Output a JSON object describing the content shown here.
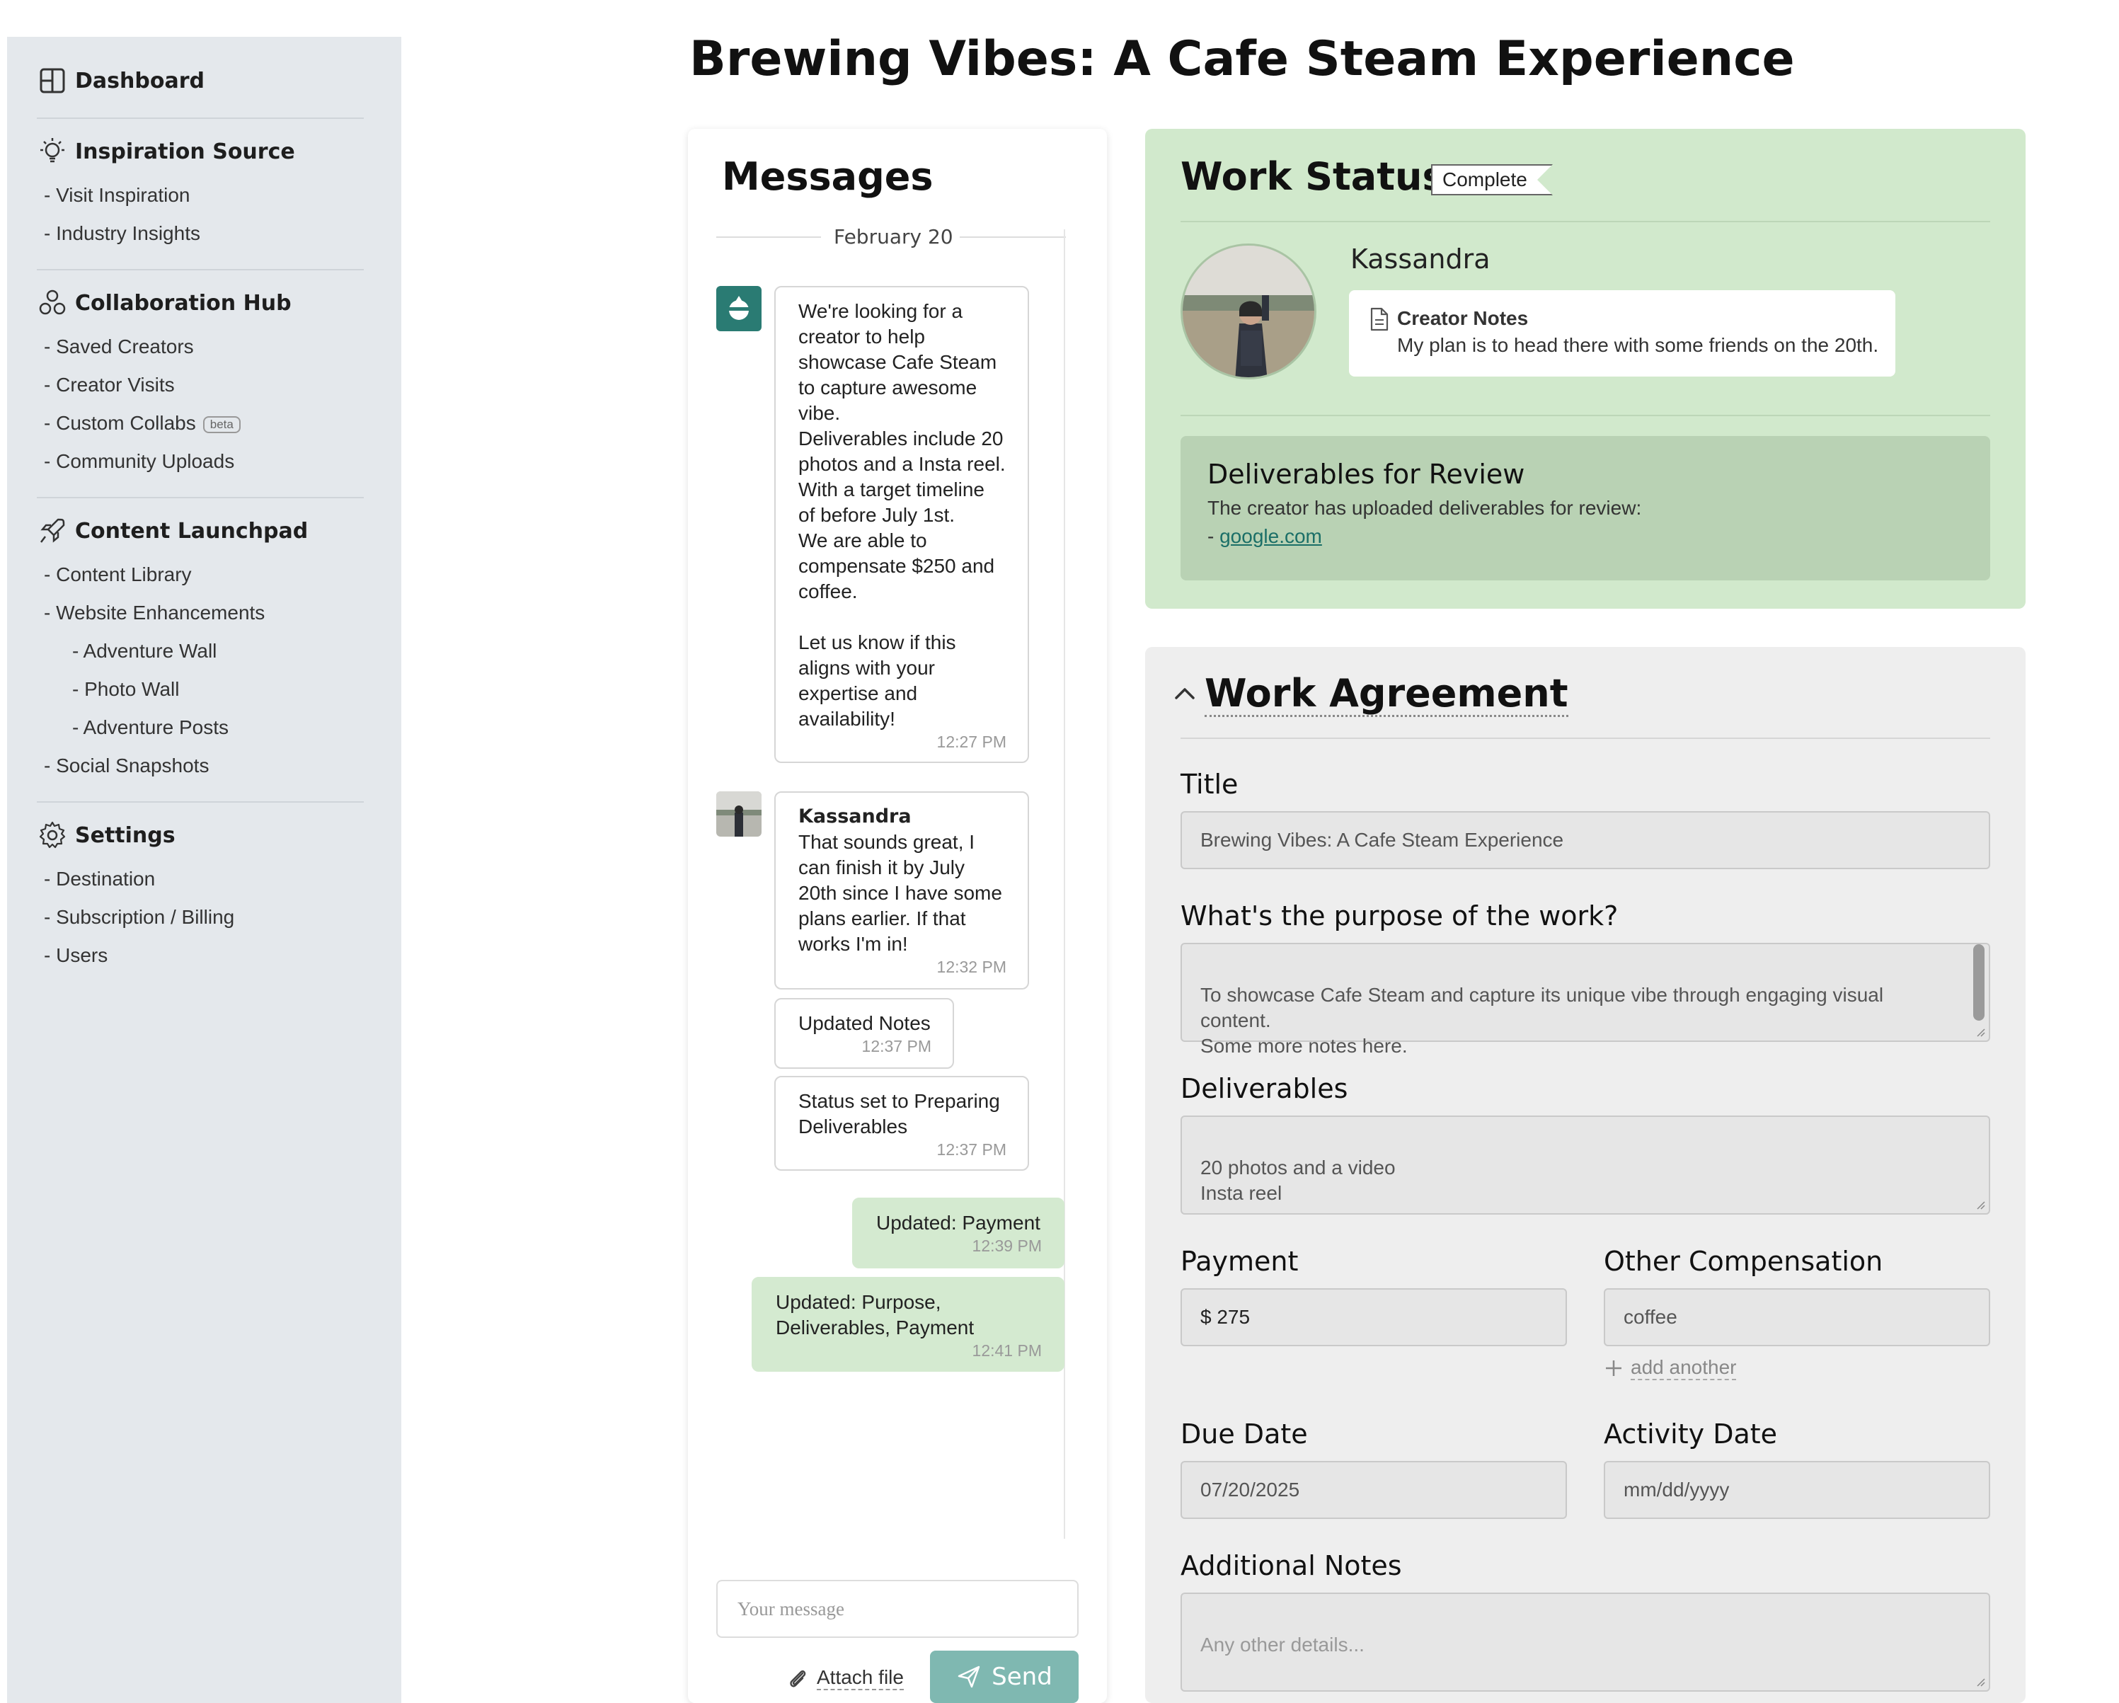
{
  "page_title": "Brewing Vibes: A Cafe Steam Experience",
  "sidebar": {
    "sections": [
      {
        "label": "Dashboard",
        "icon": "dashboard-icon",
        "items": []
      },
      {
        "label": "Inspiration Source",
        "icon": "lightbulb-icon",
        "items": [
          "- Visit Inspiration",
          "- Industry Insights"
        ]
      },
      {
        "label": "Collaboration Hub",
        "icon": "collaboration-icon",
        "items": [
          "- Saved Creators",
          "- Creator Visits",
          "- Custom Collabs",
          "- Community Uploads"
        ]
      },
      {
        "label": "Content Launchpad",
        "icon": "rocket-icon",
        "items": [
          "- Content Library",
          "- Website Enhancements",
          "- Adventure Wall",
          "- Photo Wall",
          "- Adventure Posts",
          "- Social Snapshots"
        ]
      },
      {
        "label": "Settings",
        "icon": "gear-icon",
        "items": [
          "- Destination",
          "- Subscription / Billing",
          "- Users"
        ]
      }
    ],
    "beta_badge": "beta"
  },
  "messages": {
    "title": "Messages",
    "date_separator": "February 20",
    "items": [
      {
        "author": "",
        "text": "We're looking for a creator to help showcase Cafe Steam to capture awesome vibe.\nDeliverables include 20 photos and a Insta reel. With a target timeline of before July 1st.\nWe are able to compensate $250 and coffee.\n\nLet us know if this aligns with your expertise and availability!",
        "time": "12:27 PM"
      },
      {
        "author": "Kassandra",
        "text": "That sounds great, I can finish it by July 20th since I have some plans earlier.  If that works I'm in!",
        "time": "12:32 PM"
      },
      {
        "author": "",
        "text": "Updated Notes",
        "time": "12:37 PM"
      },
      {
        "author": "",
        "text": "Status set to Preparing Deliverables",
        "time": "12:37 PM"
      },
      {
        "author": "",
        "text": "Updated: Payment",
        "time": "12:39 PM"
      },
      {
        "author": "",
        "text": "Updated: Purpose, Deliverables, Payment",
        "time": "12:41 PM"
      }
    ],
    "input_placeholder": "Your message",
    "attach_label": "Attach file",
    "send_label": "Send"
  },
  "work_status": {
    "title": "Work Status:",
    "badge": "Complete",
    "creator_name": "Kassandra",
    "notes_title": "Creator Notes",
    "notes_text": "My plan is to head there with some friends on the 20th.",
    "deliverables_title": "Deliverables for Review",
    "deliverables_text": "The creator has uploaded deliverables for review:",
    "deliverables_link_prefix": "- ",
    "deliverables_link": "google.com"
  },
  "work_agreement": {
    "title": "Work Agreement",
    "fields": {
      "title_label": "Title",
      "title_value": "Brewing Vibes: A Cafe Steam Experience",
      "purpose_label": "What's the purpose of the work?",
      "purpose_value": "To showcase Cafe Steam and capture its unique vibe through engaging visual content.\nSome more notes here.",
      "deliverables_label": "Deliverables",
      "deliverables_value": "20 photos and a video\nInsta reel",
      "payment_label": "Payment",
      "payment_value": "$ 275",
      "other_comp_label": "Other Compensation",
      "other_comp_value": "coffee",
      "add_another": "add another",
      "due_date_label": "Due Date",
      "due_date_value": "07/20/2025",
      "activity_date_label": "Activity Date",
      "activity_date_placeholder": "mm/dd/yyyy",
      "notes_label": "Additional Notes",
      "notes_placeholder": "Any other details..."
    }
  },
  "colors": {
    "sidebar_bg": "#e4e8ec",
    "brand_teal": "#2a7b73",
    "status_green": "#d1e9cc",
    "deliverables_green": "#b9d2b4",
    "send_button": "#7fb8b1",
    "message_green": "#d4ead0"
  }
}
